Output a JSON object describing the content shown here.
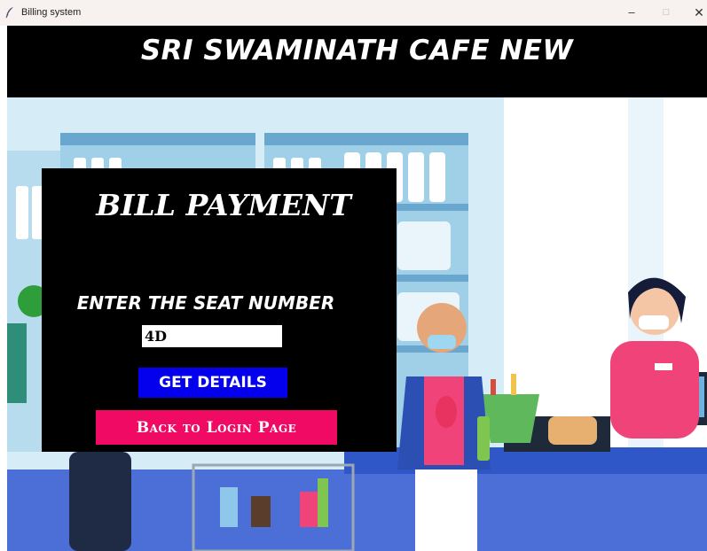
{
  "window": {
    "title": "Billing system",
    "minimize": "–",
    "maximize": "□",
    "close": "✕"
  },
  "header": {
    "title": "SRI SWAMINATH CAFE NEW"
  },
  "panel": {
    "title": "BILL PAYMENT",
    "seat_label": "ENTER THE SEAT NUMBER",
    "seat_value": "4D",
    "get_details_label": "GET DETAILS",
    "back_label": "Back to Login Page"
  },
  "colors": {
    "banner": "#000000",
    "panel": "#000000",
    "get_details_button": "#0400ee",
    "back_button": "#f00a64"
  },
  "background": {
    "image": "cartoon supermarket checkout illustration",
    "icons": [
      "feather-icon"
    ]
  }
}
